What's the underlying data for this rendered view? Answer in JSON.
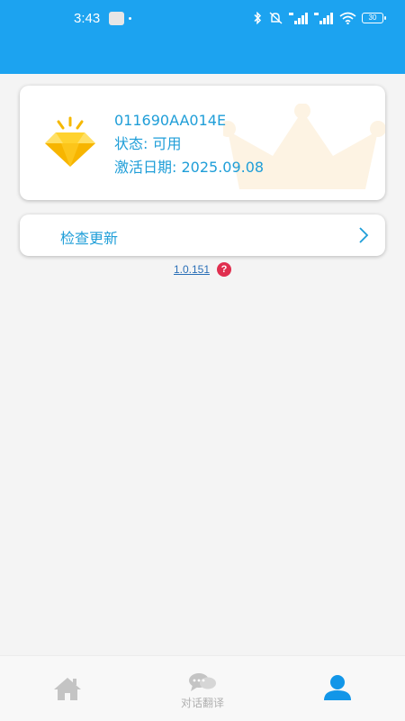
{
  "status_bar": {
    "time": "3:43",
    "battery": "30"
  },
  "license_card": {
    "device_id": "011690AA014E",
    "status_line": "状态: 可用",
    "activation_line": "激活日期: 2025.09.08",
    "icon": "diamond-icon",
    "background_icon": "crown-icon"
  },
  "update": {
    "label": "检查更新",
    "icon": "chevron-right-icon"
  },
  "version": {
    "number": "1.0.151",
    "help_glyph": "?"
  },
  "bottom_nav": {
    "items": [
      {
        "icon": "home-icon",
        "label": "",
        "active": false
      },
      {
        "icon": "chat-icon",
        "label": "对话翻译",
        "active": false
      },
      {
        "icon": "user-icon",
        "label": "",
        "active": true
      }
    ]
  },
  "colors": {
    "header": "#1ca3f0",
    "accent_text": "#1f9ed8",
    "nav_active": "#1296e8",
    "nav_inactive": "#c4c4c4",
    "help_badge": "#e02f4f"
  }
}
